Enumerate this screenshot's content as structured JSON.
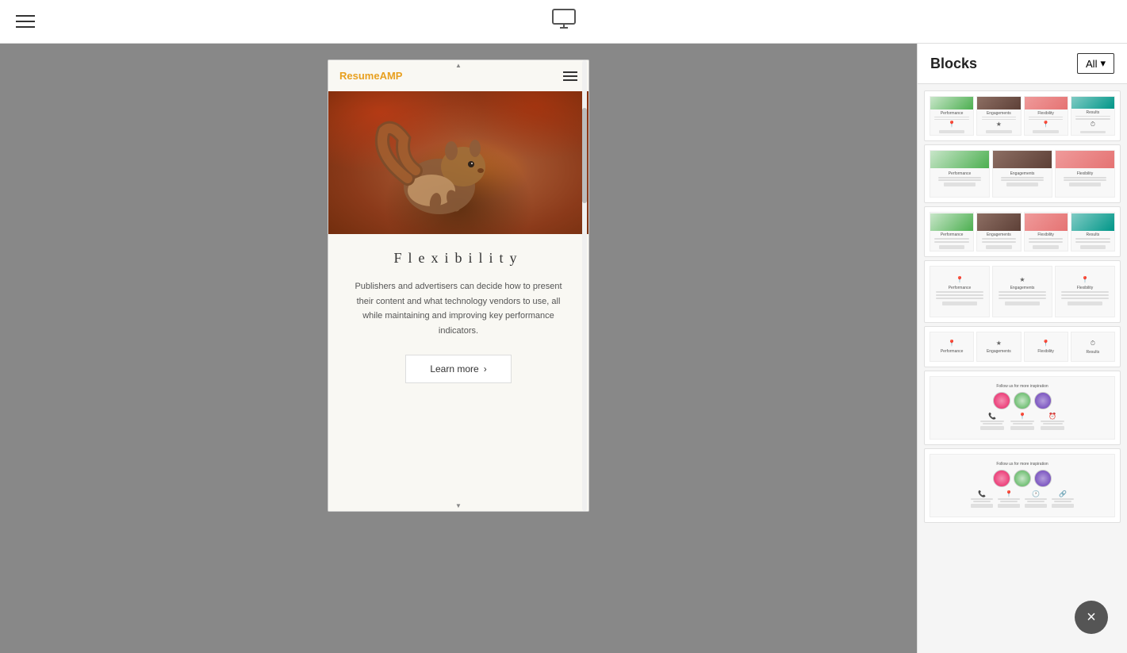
{
  "toolbar": {
    "title": "",
    "hamburger_label": "menu",
    "monitor_label": "monitor-preview"
  },
  "sidebar": {
    "title": "Blocks",
    "all_button": "All",
    "chevron": "▾",
    "blocks": [
      {
        "id": "block-1",
        "type": "4col-with-images",
        "cols": 4
      },
      {
        "id": "block-2",
        "type": "3col-with-images",
        "cols": 3
      },
      {
        "id": "block-3",
        "type": "4col-with-images-2",
        "cols": 4
      },
      {
        "id": "block-4",
        "type": "3col-icons-only",
        "cols": 3
      },
      {
        "id": "block-5",
        "type": "4col-icons-only",
        "cols": 4
      },
      {
        "id": "block-6",
        "type": "social-follow",
        "cols": 1
      },
      {
        "id": "block-7",
        "type": "social-follow-2",
        "cols": 1
      }
    ],
    "col_labels": {
      "4col": [
        "Performance",
        "Engagements",
        "Flexibility",
        "Results"
      ],
      "3col": [
        "Performance",
        "Engagements",
        "Flexibility"
      ]
    }
  },
  "preview": {
    "logo_text_1": "Resume",
    "logo_text_2": "AMP",
    "title": "Flexibility",
    "description": "Publishers and advertisers can decide how to present their content and what technology vendors to use, all while maintaining and improving key performance indicators.",
    "learn_more_btn": "Learn more",
    "chevron_right": "›"
  },
  "close_btn": "×",
  "social_title": "Follow us for more inspiration"
}
